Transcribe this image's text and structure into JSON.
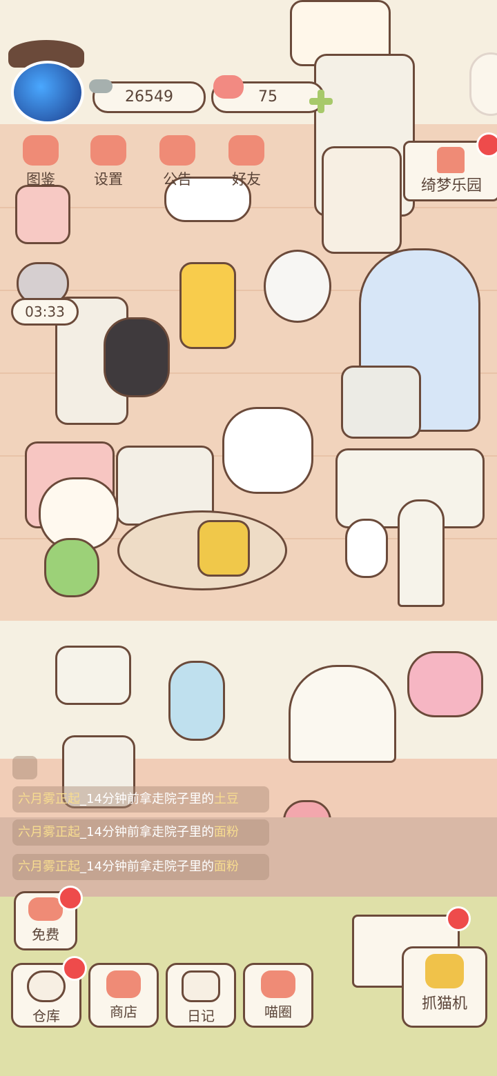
{
  "hud": {
    "fish_count": "26549",
    "heart_count": "75",
    "timer": "03:33"
  },
  "top_menu": [
    {
      "label": "图鉴",
      "icon": "cat-face-icon"
    },
    {
      "label": "设置",
      "icon": "gear-icon"
    },
    {
      "label": "公告",
      "icon": "gift-icon"
    },
    {
      "label": "好友",
      "icon": "friends-icon"
    }
  ],
  "park_sign": {
    "label": "绮梦乐园"
  },
  "chat_feed": [
    {
      "user": "六月雾正起",
      "text": "_14分钟前拿走院子里的",
      "item": "土豆"
    },
    {
      "user": "六月雾正起",
      "text": "_14分钟前拿走院子里的",
      "item": "面粉"
    },
    {
      "user": "六月雾正起",
      "text": "_14分钟前拿走院子里的",
      "item": "面粉"
    }
  ],
  "bottom_buttons": {
    "free": "免费",
    "warehouse": "仓库",
    "shop": "商店",
    "diary": "日记",
    "cat_circle": "喵圈",
    "claw_machine": "抓猫机"
  },
  "colors": {
    "outline": "#6b4a3a",
    "accent_pink": "#ef8b76",
    "notification_red": "#ee4b4b",
    "chat_item_highlight": "#f7dc90"
  }
}
